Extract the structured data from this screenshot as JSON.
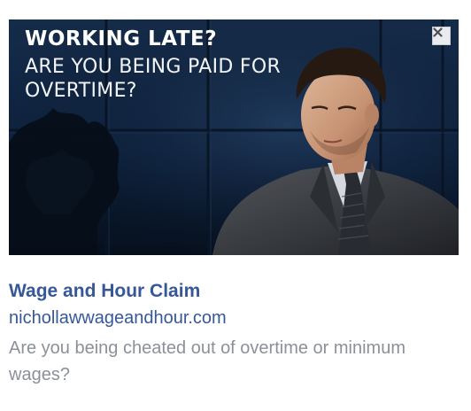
{
  "ad": {
    "image": {
      "headline_line1": "WORKING LATE?",
      "headline_line2": "ARE YOU BEING PAID FOR OVERTIME?"
    },
    "close_icon": "close-icon",
    "title": "Wage and Hour Claim",
    "url": "nichollawwageandhour.com",
    "description": "Are you being cheated out of overtime or minimum wages?"
  }
}
